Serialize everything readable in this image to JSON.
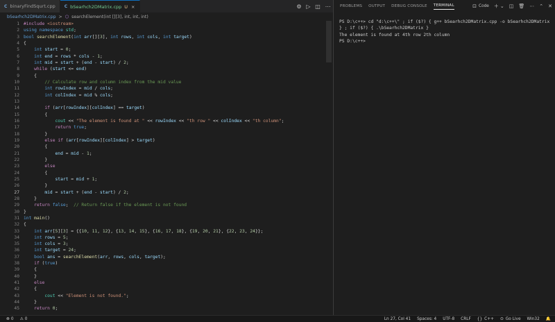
{
  "tabs": [
    {
      "icon": "C",
      "label": "binaryFindSqurt.cpp",
      "modified": "",
      "close": ""
    },
    {
      "icon": "C",
      "label": "bSearhch2DMatrix.cpp",
      "modified": "U",
      "close": "×"
    }
  ],
  "breadcrumb": {
    "file": "bSearhch2DMatrix.cpp",
    "separator": ">",
    "symbol": "searchElement(int [][3], int, int, int)"
  },
  "editor": {
    "current_line": 27,
    "lines": [
      "#include <iostream>",
      "using namespace std;",
      "bool searchElement(int arr[][3], int rows, int cols, int target)",
      "{",
      "    int start = 0;",
      "    int end = rows * cols - 1;",
      "    int mid = start + (end - start) / 2;",
      "    while (start <= end)",
      "    {",
      "        // Calculate row and column index from the mid value",
      "        int rowIndex = mid / cols;",
      "        int colIndex = mid % cols;",
      "",
      "        if (arr[rowIndex][colIndex] == target)",
      "        {",
      "            cout << \"The element is found at \" << rowIndex << \"th row \" << colIndex << \"th column\";",
      "            return true;",
      "        }",
      "        else if (arr[rowIndex][colIndex] > target)",
      "        {",
      "            end = mid - 1;",
      "        }",
      "        else",
      "        {",
      "            start = mid + 1;",
      "        }",
      "        mid = start + (end - start) / 2;",
      "    }",
      "    return false;  // Return false if the element is not found",
      "}",
      "int main()",
      "{",
      "    int arr[5][3] = {{10, 11, 12}, {13, 14, 15}, {16, 17, 18}, {19, 20, 21}, {22, 23, 24}};",
      "    int rows = 5;",
      "    int cols = 3;",
      "    int target = 24;",
      "    bool ans = searchElement(arr, rows, cols, target);",
      "    if (true)",
      "    {",
      "    }",
      "    else",
      "    {",
      "        cout << \"Element is not found.\";",
      "    }",
      "    return 0;"
    ]
  },
  "panel": {
    "tabs": [
      "PROBLEMS",
      "OUTPUT",
      "DEBUG CONSOLE",
      "TERMINAL"
    ],
    "active_tab": "TERMINAL",
    "shell_label": "Code"
  },
  "terminal": {
    "lines": [
      "PS D:\\c++> cd \"d:\\c++\\\" ; if ($?) { g++ bSearhch2DMatrix.cpp -o bSearhch2DMatrix } ; if ($?) { .\\bSearhch2DMatrix }",
      "The element is found at 4th row 2th column",
      "PS D:\\c++>"
    ]
  },
  "statusbar": {
    "errors": "0",
    "warnings": "0",
    "position": "Ln 27, Col 41",
    "spaces": "Spaces: 4",
    "encoding": "UTF-8",
    "eol": "CRLF",
    "language": "C++",
    "golive": "Go Live",
    "platform": "Win32"
  },
  "colors": {
    "keyword": "#569cd6",
    "control": "#c586c0",
    "type": "#4ec9b0",
    "function": "#dcdcaa",
    "variable": "#9cdcfe",
    "string": "#ce9178",
    "number": "#b5cea8",
    "comment": "#6a9955"
  }
}
